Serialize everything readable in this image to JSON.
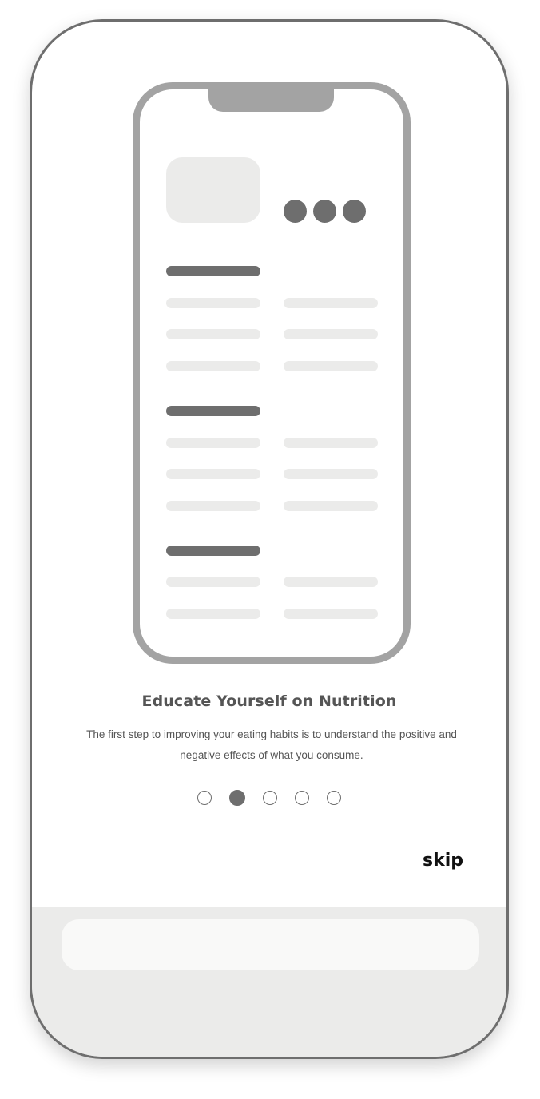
{
  "onboarding": {
    "title": "Educate Yourself on Nutrition",
    "description": "The first step to improving your eating habits is to understand the positive and negative effects of what you consume.",
    "pager": {
      "total": 5,
      "active_index": 1
    },
    "skip_label": "skip"
  },
  "colors": {
    "frame": "#6e6e6e",
    "illustration_frame": "#a3a3a3",
    "dark_bar": "#6e6e6e",
    "light_bar": "#ebebea",
    "bottom_area": "#ebebea",
    "bottom_bar": "#f9f9f8",
    "text": "#555555",
    "skip_text": "#111111"
  }
}
